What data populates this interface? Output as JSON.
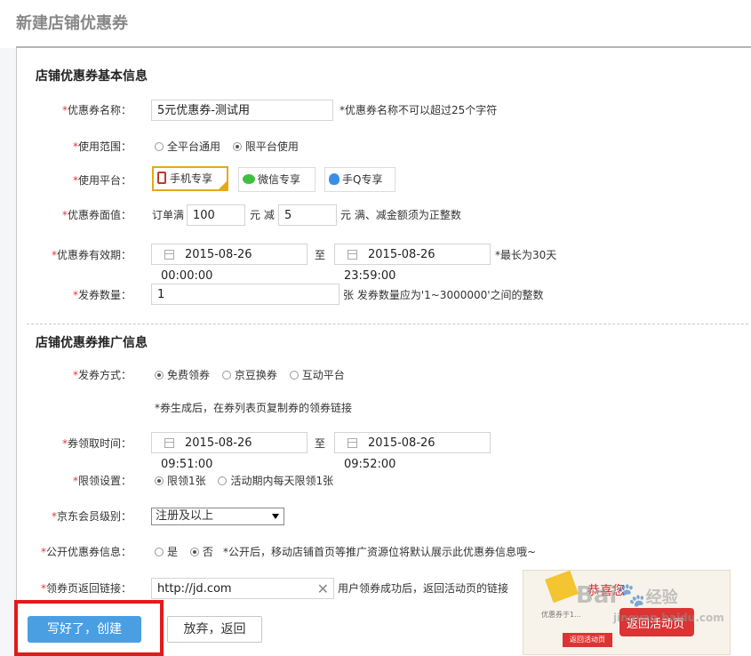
{
  "page_title": "新建店铺优惠券",
  "basic": {
    "title": "店铺优惠券基本信息",
    "name_label": "优惠券名称：",
    "name_value": "5元优惠券-测试用",
    "name_hint": "*优惠券名称不可以超过25个字符",
    "scope_label": "使用范围：",
    "scope_options": [
      "全平台通用",
      "限平台使用"
    ],
    "platform_label": "使用平台：",
    "platforms": [
      "手机专享",
      "微信专享",
      "手Q专享"
    ],
    "face_label": "优惠券面值：",
    "order_full": "订单满",
    "order_amount": "100",
    "yuan_minus": "元 减",
    "minus_amount": "5",
    "face_hint": "元 满、减金额须为正整数",
    "valid_label": "优惠券有效期：",
    "valid_start": "2015-08-26 00:00:00",
    "to": "至",
    "valid_end": "2015-08-26 23:59:00",
    "valid_hint": "*最长为30天",
    "count_label": "发券数量：",
    "count_value": "1",
    "count_hint": "张 发券数量应为'1~3000000'之间的整数"
  },
  "promo": {
    "title": "店铺优惠券推广信息",
    "method_label": "发券方式：",
    "method_options": [
      "免费领券",
      "京豆换券",
      "互动平台"
    ],
    "method_hint": "*券生成后，在券列表页复制券的领券链接",
    "claim_label": "券领取时间：",
    "claim_start": "2015-08-26 09:51:00",
    "claim_end": "2015-08-26 09:52:00",
    "limit_label": "限领设置：",
    "limit_options": [
      "限领1张",
      "活动期内每天限领1张"
    ],
    "level_label": "京东会员级别：",
    "level_value": "注册及以上",
    "public_label": "公开优惠券信息：",
    "public_options": [
      "是",
      "否"
    ],
    "public_hint": "*公开后，移动店铺首页等推广资源位将默认展示此优惠券信息哦~",
    "link_label": "领券页返回链接：",
    "link_value": "http://jd.com",
    "link_hint": "用户领券成功后，返回活动页的链接"
  },
  "buttons": {
    "create": "写好了，创建",
    "cancel": "放弃，返回"
  },
  "popup": {
    "congrats": "恭喜您",
    "back": "返回活动页",
    "small_text": "优惠券于1...",
    "small_btn": "返回活动页"
  },
  "watermark": {
    "brand": "Bai",
    "suffix": "经验",
    "url": "jingyan.baidu.com"
  },
  "colors": {
    "required": "#e4393c",
    "primary_button": "#4a9fe3",
    "highlight_border": "#e21a1a",
    "selected_platform": "#e6a817"
  }
}
